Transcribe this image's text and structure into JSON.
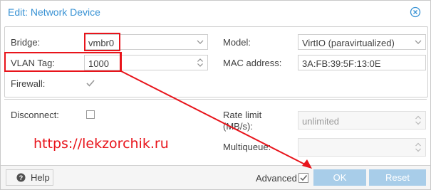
{
  "dialog": {
    "title": "Edit: Network Device"
  },
  "form": {
    "bridge": {
      "label": "Bridge:",
      "value": "vmbr0"
    },
    "vlan_tag": {
      "label": "VLAN Tag:",
      "value": "1000"
    },
    "firewall": {
      "label": "Firewall:",
      "checked": true
    },
    "disconnect": {
      "label": "Disconnect:",
      "checked": false
    },
    "model": {
      "label": "Model:",
      "value": "VirtIO (paravirtualized)"
    },
    "mac_address": {
      "label": "MAC address:",
      "value": "3A:FB:39:5F:13:0E"
    },
    "rate_limit": {
      "label_line1": "Rate limit",
      "label_line2": "(MB/s):",
      "placeholder": "unlimited"
    },
    "multiqueue": {
      "label": "Multiqueue:",
      "value": ""
    }
  },
  "footer": {
    "help_label": "Help",
    "advanced_label": "Advanced",
    "advanced_checked": true,
    "ok_label": "OK",
    "reset_label": "Reset"
  },
  "annotation": {
    "watermark": "https://lekzorchik.ru",
    "color": "#e8141b"
  },
  "colors": {
    "title": "#3892d4",
    "button_disabled": "#a8cde9"
  },
  "icons": {
    "close": "close-circle-icon",
    "help": "question-circle-icon",
    "dropdown": "chevron-down-icon",
    "spinner": "spinner-arrows-icon"
  }
}
